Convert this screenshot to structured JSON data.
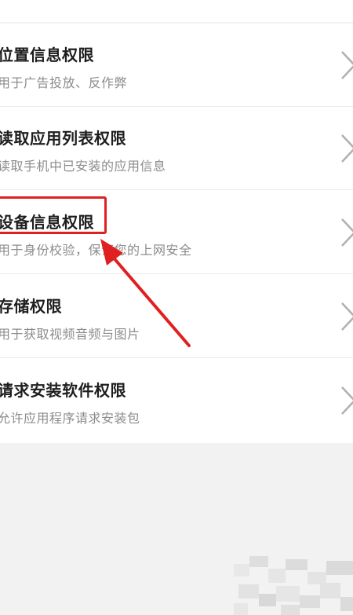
{
  "permissions": [
    {
      "title": "位置信息权限",
      "desc": "用于广告投放、反作弊"
    },
    {
      "title": "读取应用列表权限",
      "desc": "读取手机中已安装的应用信息"
    },
    {
      "title": "设备信息权限",
      "desc": "用于身份校验，保证您的上网安全"
    },
    {
      "title": "存储权限",
      "desc": "用于获取视频音频与图片"
    },
    {
      "title": "请求安装软件权限",
      "desc": "允许应用程序请求安装包"
    }
  ],
  "colors": {
    "annotation": "#e02020",
    "chevron": "#b0b0b0",
    "background": "#f2f2f2"
  },
  "icons": {
    "row_chevron": "chevron-right-icon",
    "annotation_arrow": "red-arrow-icon"
  }
}
